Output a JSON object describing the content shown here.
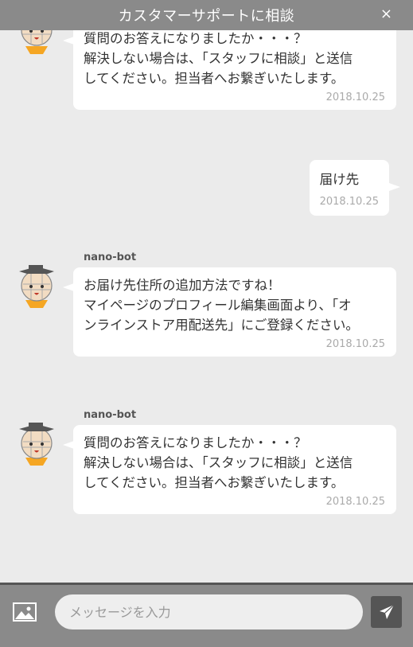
{
  "header": {
    "title": "カスタマーサポートに相談",
    "close_label": "×"
  },
  "messages": [
    {
      "lines": [
        "質問のお答えになりましたか・・・？",
        "解決しない場合は、「スタッフに相談」と送信",
        "してください。担当者へお繋ぎいたします。"
      ],
      "timestamp": "2018.10.25"
    },
    {
      "lines": [
        "届け先"
      ],
      "timestamp": "2018.10.25"
    },
    {
      "sender": "nano-bot",
      "lines": [
        "お届け先住所の追加方法ですね！",
        "マイページのプロフィール編集画面より、「オ",
        "ンラインストア用配送先」にご登録ください。"
      ],
      "timestamp": "2018.10.25"
    },
    {
      "sender": "nano-bot",
      "lines": [
        "質問のお答えになりましたか・・・？",
        "解決しない場合は、「スタッフに相談」と送信",
        "してください。担当者へお繋ぎいたします。"
      ],
      "timestamp": "2018.10.25"
    }
  ],
  "composer": {
    "placeholder": "メッセージを入力"
  },
  "colors": {
    "header": "#8a8a8a",
    "background": "#ebebeb",
    "bubble": "#ffffff",
    "avatar_collar": "#f5a623",
    "send_button": "#555555"
  },
  "icons": {
    "image": "image-icon",
    "send": "send-icon",
    "avatar": "bot-avatar-icon"
  }
}
